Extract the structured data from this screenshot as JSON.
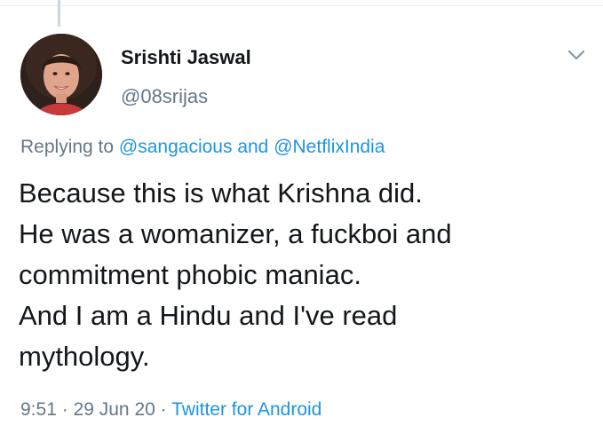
{
  "author": {
    "name": "Srishti Jaswal",
    "handle": "@08srijas"
  },
  "reply": {
    "prefix": "Replying to",
    "user1": "@sangacious",
    "conjunction": "and",
    "user2": "@NetflixIndia"
  },
  "body_lines": [
    "Because this is what Krishna did.",
    "He was a womanizer, a fuckboi and",
    "commitment phobic maniac.",
    "And I am a Hindu and I've read",
    "mythology."
  ],
  "meta": {
    "time": "9:51",
    "separator": "·",
    "date": "29 Jun 20",
    "source": "Twitter for Android"
  },
  "colors": {
    "link": "#1b95e0",
    "secondary_text": "#657786",
    "primary_text": "#14171a"
  },
  "icons": {
    "menu": "chevron-down-icon"
  }
}
